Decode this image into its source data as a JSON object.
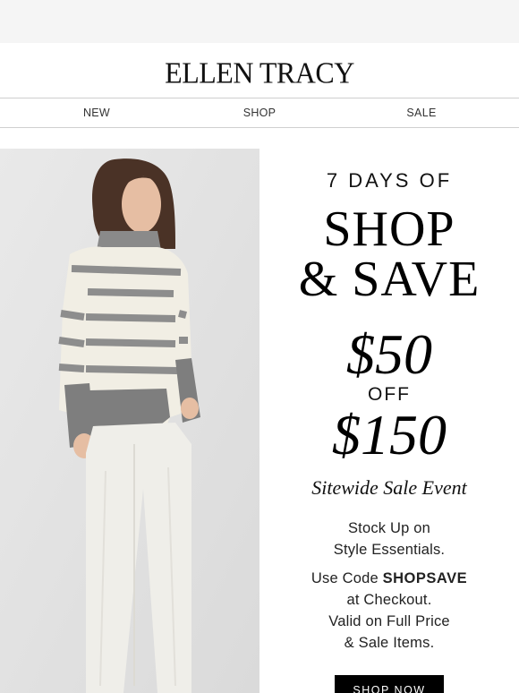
{
  "brand": {
    "logo_text": "ELLEN TRACY"
  },
  "nav": {
    "items": [
      {
        "label": "NEW"
      },
      {
        "label": "SHOP"
      },
      {
        "label": "SALE"
      }
    ]
  },
  "promo": {
    "days_label": "7 DAYS OF",
    "headline_line1": "SHOP",
    "headline_line2": "& SAVE",
    "discount_amount": "$50",
    "off_label": "OFF",
    "threshold_amount": "$150",
    "event_label": "Sitewide Sale Event",
    "stock_line1": "Stock Up on",
    "stock_line2": "Style Essentials.",
    "code_prefix": "Use Code ",
    "code_value": "SHOPSAVE",
    "code_line2": "at Checkout.",
    "valid_line1": "Valid on Full Price",
    "valid_line2": "& Sale Items.",
    "cta_label": "SHOP NOW"
  },
  "colors": {
    "background": "#ffffff",
    "top_strip": "#f5f5f5",
    "divider": "#cfcfcf",
    "text": "#111111",
    "cta_background": "#000000",
    "cta_text": "#ffffff",
    "photo_backdrop": "#e4e4e4",
    "sweater_cream": "#f1eee4",
    "sweater_stripe": "#8d8d8d"
  }
}
